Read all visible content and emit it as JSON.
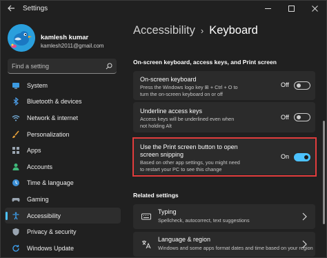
{
  "app": {
    "title": "Settings"
  },
  "profile": {
    "name": "kamlesh kumar",
    "email": "kamlesh2011@gmail.com"
  },
  "search": {
    "placeholder": "Find a setting"
  },
  "sidebar": {
    "items": [
      {
        "label": "System",
        "icon": "monitor-icon"
      },
      {
        "label": "Bluetooth & devices",
        "icon": "bluetooth-icon"
      },
      {
        "label": "Network & internet",
        "icon": "wifi-icon"
      },
      {
        "label": "Personalization",
        "icon": "brush-icon"
      },
      {
        "label": "Apps",
        "icon": "apps-icon"
      },
      {
        "label": "Accounts",
        "icon": "person-icon"
      },
      {
        "label": "Time & language",
        "icon": "globe-clock-icon"
      },
      {
        "label": "Gaming",
        "icon": "gamepad-icon"
      },
      {
        "label": "Accessibility",
        "icon": "accessibility-icon",
        "active": true
      },
      {
        "label": "Privacy & security",
        "icon": "shield-icon"
      },
      {
        "label": "Windows Update",
        "icon": "update-icon"
      }
    ]
  },
  "breadcrumb": {
    "parent": "Accessibility",
    "separator": "›",
    "current": "Keyboard"
  },
  "section": {
    "heading": "On-screen keyboard, access keys, and Print screen"
  },
  "settings": [
    {
      "title": "On-screen keyboard",
      "desc_line1": "Press the Windows logo key ⊞ + Ctrl + O to",
      "desc_line2": "turn the on-screen keyboard on or off",
      "state_label": "Off",
      "on": false
    },
    {
      "title": "Underline access keys",
      "desc_line1": "Access keys will be underlined even when",
      "desc_line2": "not holding Alt",
      "state_label": "Off",
      "on": false
    },
    {
      "title_line1": "Use the Print screen button to open",
      "title_line2": "screen snipping",
      "desc_line1": "Based on other app settings, you might need",
      "desc_line2": "to restart your PC to see this change",
      "state_label": "On",
      "on": true
    }
  ],
  "related": {
    "heading": "Related settings",
    "items": [
      {
        "title": "Typing",
        "desc": "Spellcheck, autocorrect, text suggestions",
        "icon": "keyboard-icon"
      },
      {
        "title": "Language & region",
        "desc": "Windows and some apps format dates and time based on your region",
        "icon": "language-icon"
      }
    ]
  },
  "colors": {
    "accent": "#4cc2ff",
    "highlight": "#e23d3d",
    "background": "#202020",
    "card": "#2b2b2b"
  }
}
